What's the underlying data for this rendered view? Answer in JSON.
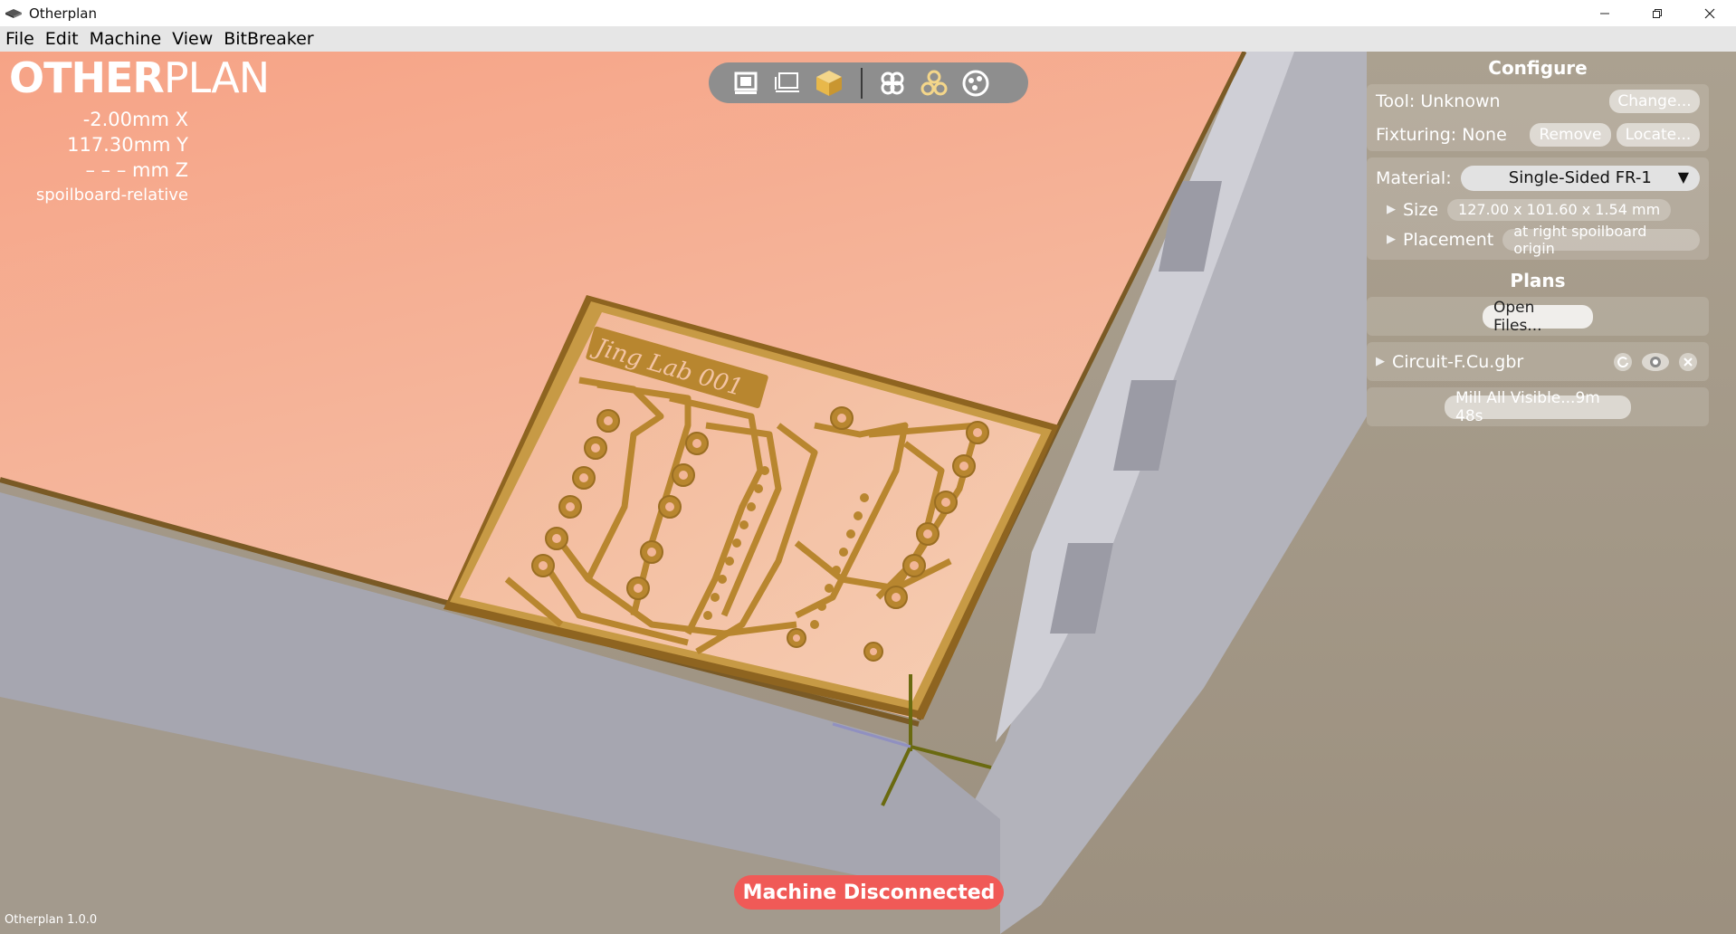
{
  "window": {
    "title": "Otherplan",
    "controls": [
      "minimize-icon",
      "restore-icon",
      "close-icon"
    ]
  },
  "menu": {
    "items": [
      "File",
      "Edit",
      "Machine",
      "View",
      "BitBreaker"
    ]
  },
  "logo": {
    "part1": "OTHER",
    "part2": "PLAN"
  },
  "readout": {
    "x": "-2.00mm X",
    "y": "117.30mm Y",
    "z": "– – – mm Z",
    "reference": "spoilboard-relative"
  },
  "toolbar": {
    "view_buttons": [
      "top-view-icon",
      "front-view-icon",
      "iso-view-icon"
    ],
    "plan_buttons": [
      "flip-board-icon",
      "plan-view-icon",
      "rotate-plan-icon"
    ]
  },
  "configure": {
    "header": "Configure",
    "tool_label": "Tool: Unknown",
    "tool_change": "Change...",
    "fixturing_label": "Fixturing: None",
    "fixturing_remove": "Remove",
    "fixturing_locate": "Locate...",
    "material_label": "Material:",
    "material_value": "Single-Sided FR-1",
    "size_label": "Size",
    "size_value": "127.00 x 101.60 x 1.54 mm",
    "placement_label": "Placement",
    "placement_value": "at right spoilboard origin"
  },
  "plans": {
    "header": "Plans",
    "open_files": "Open Files...",
    "file_name": "Circuit-F.Cu.gbr",
    "mill_button": "Mill All Visible...9m 48s"
  },
  "pcb": {
    "label": "Jing Lab 001"
  },
  "status": {
    "text": "Machine Disconnected"
  },
  "version": "Otherplan 1.0.0",
  "colors": {
    "spoilboard_top": "#f3a98b",
    "machine_gray": "#a7a7b1",
    "floor": "#a39a8d",
    "copper": "#b8862f",
    "status_red": "#f05a57"
  }
}
